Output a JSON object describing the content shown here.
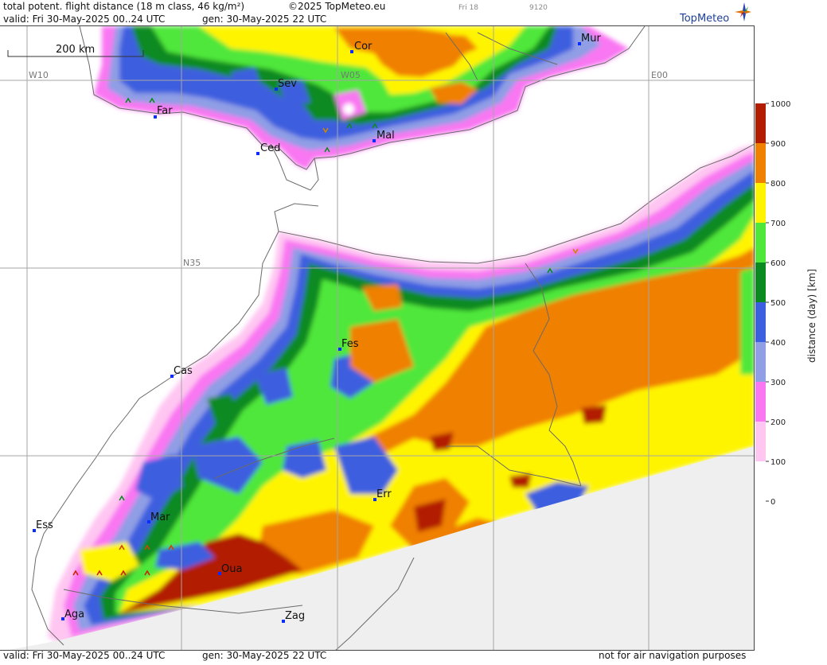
{
  "header": {
    "title": "total potent. flight distance (18 m class, 46 kg/m²)",
    "copyright": "©2025 TopMeteo.eu",
    "frame_day": "Fri 18",
    "code": "9120",
    "valid": "valid:  Fri  30-May-2025  00..24 UTC",
    "gen": "gen: 30-May-2025 22 UTC"
  },
  "footer": {
    "valid": "valid:  Fri  30-May-2025  00..24 UTC",
    "gen": "gen: 30-May-2025 22 UTC",
    "disclaimer": "not for air navigation purposes"
  },
  "logo": {
    "text": "TopMeteo"
  },
  "scale_bar": {
    "label": "200 km"
  },
  "grid_labels": {
    "w10": "W10",
    "w05": "W05",
    "e00": "E00",
    "n35": "N35"
  },
  "cities": [
    {
      "id": "cor",
      "label": "Cor"
    },
    {
      "id": "mur",
      "label": "Mur"
    },
    {
      "id": "sev",
      "label": "Sev"
    },
    {
      "id": "far",
      "label": "Far"
    },
    {
      "id": "ced",
      "label": "Ced"
    },
    {
      "id": "mal",
      "label": "Mal"
    },
    {
      "id": "fes",
      "label": "Fes"
    },
    {
      "id": "cas",
      "label": "Cas"
    },
    {
      "id": "err",
      "label": "Err"
    },
    {
      "id": "mar",
      "label": "Mar"
    },
    {
      "id": "ess",
      "label": "Ess"
    },
    {
      "id": "oua",
      "label": "Oua"
    },
    {
      "id": "aga",
      "label": "Aga"
    },
    {
      "id": "zag",
      "label": "Zag"
    }
  ],
  "legend": {
    "title": "distance (day) [km]",
    "bands": [
      {
        "from": 0,
        "to": 100,
        "color": "#ffffff"
      },
      {
        "from": 100,
        "to": 200,
        "color": "#ffc6f2"
      },
      {
        "from": 200,
        "to": 300,
        "color": "#f977f2"
      },
      {
        "from": 300,
        "to": 400,
        "color": "#8f9ee5"
      },
      {
        "from": 400,
        "to": 500,
        "color": "#3c5fdf"
      },
      {
        "from": 500,
        "to": 600,
        "color": "#0c8a22"
      },
      {
        "from": 600,
        "to": 700,
        "color": "#4fe73a"
      },
      {
        "from": 700,
        "to": 800,
        "color": "#fff400"
      },
      {
        "from": 800,
        "to": 900,
        "color": "#f08000"
      },
      {
        "from": 900,
        "to": 1000,
        "color": "#b21d00"
      }
    ],
    "ticks": [
      "1000",
      "900",
      "800",
      "700",
      "600",
      "500",
      "400",
      "300",
      "200",
      "100",
      "0"
    ]
  },
  "colors": {
    "no_data": "#efefef",
    "grid": "#a6a6a6",
    "coast": "#6a6a6a",
    "city_marker": "#0b2cff"
  }
}
